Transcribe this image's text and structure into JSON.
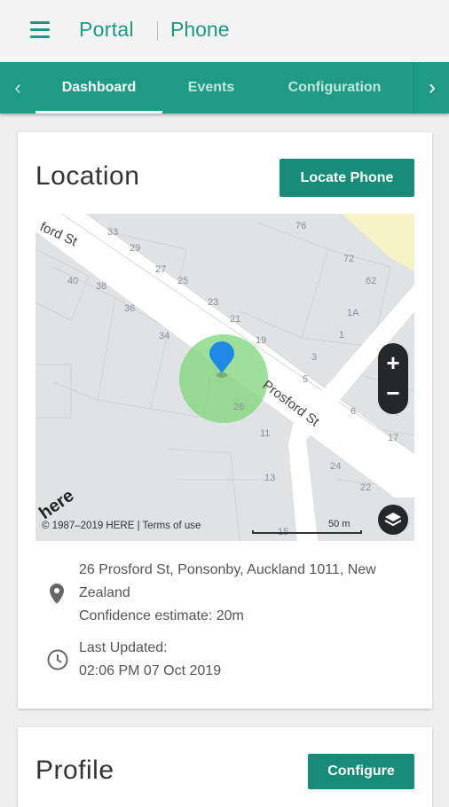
{
  "app": {
    "brand": "Portal",
    "section": "Phone"
  },
  "tabs": [
    {
      "label": "Dashboard",
      "active": true
    },
    {
      "label": "Events",
      "active": false
    },
    {
      "label": "Configuration",
      "active": false
    }
  ],
  "location_card": {
    "title": "Location",
    "locate_button": "Locate Phone",
    "map": {
      "copyright": "© 1987–2019 HERE | Terms of use",
      "scale": "50 m",
      "logo": "here",
      "streets": [
        "ford St",
        "Prosford St"
      ],
      "house_numbers": [
        "33",
        "29",
        "27",
        "25",
        "23",
        "21",
        "19",
        "40",
        "38",
        "36",
        "34",
        "76",
        "72",
        "62",
        "1A",
        "1",
        "3",
        "5",
        "6",
        "17",
        "24",
        "22",
        "26",
        "11",
        "13",
        "15"
      ],
      "zoom_in": "+",
      "zoom_out": "−"
    },
    "address_lines": [
      "26 Prosford St, Ponsonby, Auckland 1011, New",
      "Zealand"
    ],
    "confidence": "Confidence estimate: 20m",
    "last_updated_label": "Last Updated:",
    "last_updated_value": "02:06 PM 07 Oct 2019"
  },
  "profile_card": {
    "title": "Profile",
    "configure_button": "Configure"
  },
  "colors": {
    "brand": "#1a9882",
    "tabbar": "#1f9a84",
    "button": "#178c78",
    "pin": "#1e88e5",
    "accuracy": "#7cd67a"
  }
}
